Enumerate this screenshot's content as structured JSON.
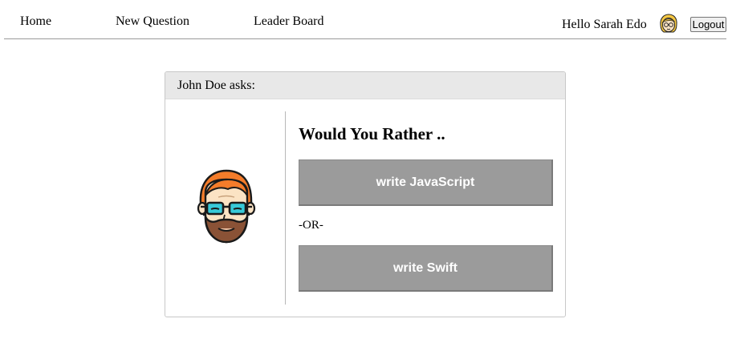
{
  "nav": {
    "home_label": "Home",
    "new_question_label": "New Question",
    "leader_board_label": "Leader Board"
  },
  "user": {
    "greeting": "Hello Sarah Edo",
    "avatar_icon": "woman-with-glasses-avatar",
    "logout_label": "Logout"
  },
  "question": {
    "header": "John Doe asks:",
    "author_avatar_icon": "man-with-glasses-beard-avatar",
    "title": "Would You Rather ..",
    "option_one": "write JavaScript",
    "separator": "-OR-",
    "option_two": "write Swift"
  },
  "colors": {
    "option_button_bg": "#9b9b9b",
    "card_header_bg": "#e8e8e8",
    "hair_orange": "#f47c2a"
  }
}
